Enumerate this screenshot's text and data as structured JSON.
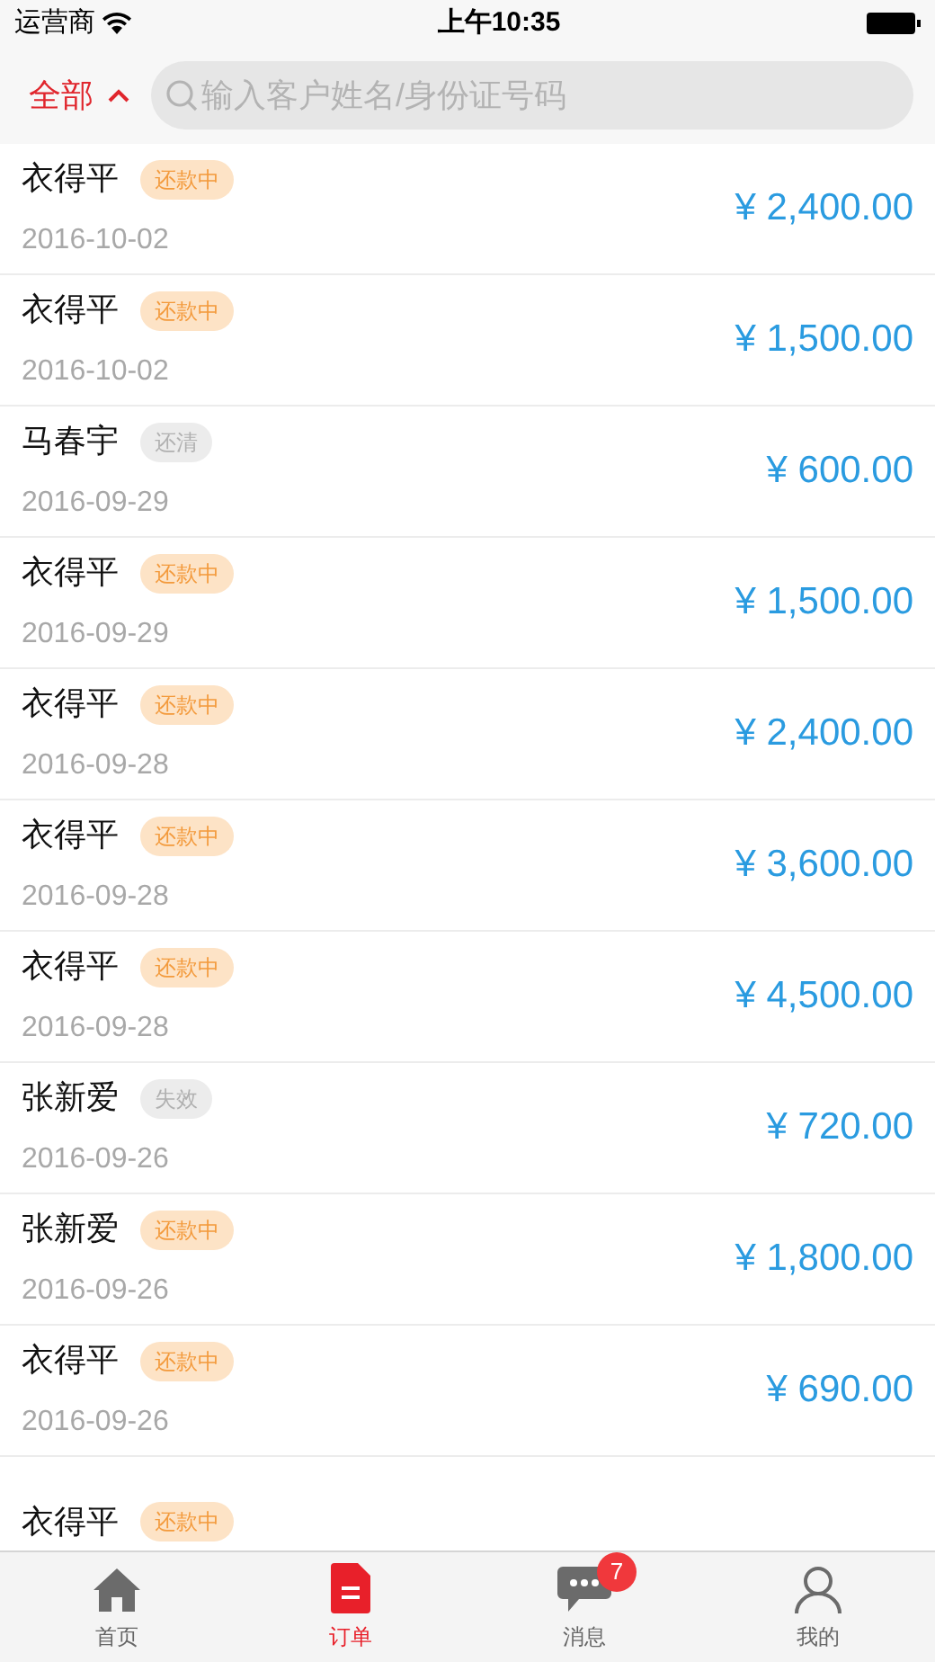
{
  "status_bar": {
    "carrier": "运营商",
    "time": "上午10:35"
  },
  "header": {
    "filter": {
      "label": "全部",
      "expanded": true
    },
    "search": {
      "placeholder": "输入客户姓名/身份证号码"
    }
  },
  "orders": [
    {
      "name": "衣得平",
      "status": {
        "label": "还款中",
        "kind": "active"
      },
      "date": "2016-10-02",
      "amount": "¥ 2,400.00"
    },
    {
      "name": "衣得平",
      "status": {
        "label": "还款中",
        "kind": "active"
      },
      "date": "2016-10-02",
      "amount": "¥ 1,500.00"
    },
    {
      "name": "马春宇",
      "status": {
        "label": "还清",
        "kind": "inactive"
      },
      "date": "2016-09-29",
      "amount": "¥ 600.00"
    },
    {
      "name": "衣得平",
      "status": {
        "label": "还款中",
        "kind": "active"
      },
      "date": "2016-09-29",
      "amount": "¥ 1,500.00"
    },
    {
      "name": "衣得平",
      "status": {
        "label": "还款中",
        "kind": "active"
      },
      "date": "2016-09-28",
      "amount": "¥ 2,400.00"
    },
    {
      "name": "衣得平",
      "status": {
        "label": "还款中",
        "kind": "active"
      },
      "date": "2016-09-28",
      "amount": "¥ 3,600.00"
    },
    {
      "name": "衣得平",
      "status": {
        "label": "还款中",
        "kind": "active"
      },
      "date": "2016-09-28",
      "amount": "¥ 4,500.00"
    },
    {
      "name": "张新爱",
      "status": {
        "label": "失效",
        "kind": "inactive"
      },
      "date": "2016-09-26",
      "amount": "¥ 720.00"
    },
    {
      "name": "张新爱",
      "status": {
        "label": "还款中",
        "kind": "active"
      },
      "date": "2016-09-26",
      "amount": "¥ 1,800.00"
    },
    {
      "name": "衣得平",
      "status": {
        "label": "还款中",
        "kind": "active"
      },
      "date": "2016-09-26",
      "amount": "¥ 690.00"
    },
    {
      "name": "衣得平",
      "status": {
        "label": "还款中",
        "kind": "active"
      }
    }
  ],
  "tab_bar": [
    {
      "label": "首页",
      "kind": "home",
      "selected": false
    },
    {
      "label": "订单",
      "kind": "orders",
      "selected": true
    },
    {
      "label": "消息",
      "kind": "messages",
      "selected": false,
      "badge": "7"
    },
    {
      "label": "我的",
      "kind": "profile",
      "selected": false
    }
  ]
}
